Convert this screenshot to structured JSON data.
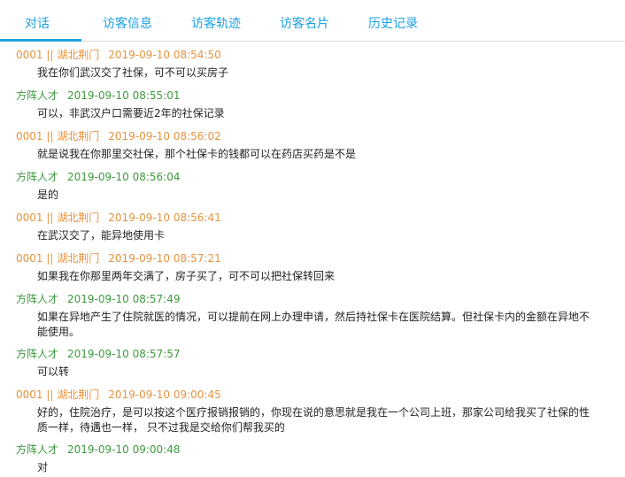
{
  "tabs": [
    {
      "label": "对话",
      "active": true
    },
    {
      "label": "访客信息",
      "active": false
    },
    {
      "label": "访客轨迹",
      "active": false
    },
    {
      "label": "访客名片",
      "active": false
    },
    {
      "label": "历史记录",
      "active": false
    }
  ],
  "colors": {
    "accent": "#1da1e2",
    "visitor_name": "#e7933d",
    "agent_name": "#3e9a3e",
    "message_text": "#222222"
  },
  "messages": [
    {
      "sender": "0001 || 湖北荆门",
      "time": "2019-09-10 08:54:50",
      "role": "visitor",
      "text": "我在你们武汉交了社保，可不可以买房子"
    },
    {
      "sender": "方阵人才",
      "time": "2019-09-10 08:55:01",
      "role": "agent",
      "text": "可以，非武汉户口需要近2年的社保记录"
    },
    {
      "sender": "0001 || 湖北荆门",
      "time": "2019-09-10 08:56:02",
      "role": "visitor",
      "text": "就是说我在你那里交社保，那个社保卡的钱都可以在药店买药是不是"
    },
    {
      "sender": "方阵人才",
      "time": "2019-09-10 08:56:04",
      "role": "agent",
      "text": "是的"
    },
    {
      "sender": "0001 || 湖北荆门",
      "time": "2019-09-10 08:56:41",
      "role": "visitor",
      "text": "在武汉交了，能异地使用卡"
    },
    {
      "sender": "0001 || 湖北荆门",
      "time": "2019-09-10 08:57:21",
      "role": "visitor",
      "text": "如果我在你那里两年交满了，房子买了，可不可以把社保转回来"
    },
    {
      "sender": "方阵人才",
      "time": "2019-09-10 08:57:49",
      "role": "agent",
      "text": "如果在异地产生了住院就医的情况，可以提前在网上办理申请，然后持社保卡在医院结算。但社保卡内的金额在异地不能使用。"
    },
    {
      "sender": "方阵人才",
      "time": "2019-09-10 08:57:57",
      "role": "agent",
      "text": "可以转"
    },
    {
      "sender": "0001 || 湖北荆门",
      "time": "2019-09-10 09:00:45",
      "role": "visitor",
      "text": "好的，住院治疗，是可以按这个医疗报销报销的，你现在说的意思就是我在一个公司上班，那家公司给我买了社保的性质一样，待遇也一样， 只不过我是交给你们帮我买的"
    },
    {
      "sender": "方阵人才",
      "time": "2019-09-10 09:00:48",
      "role": "agent",
      "text": "对"
    }
  ]
}
